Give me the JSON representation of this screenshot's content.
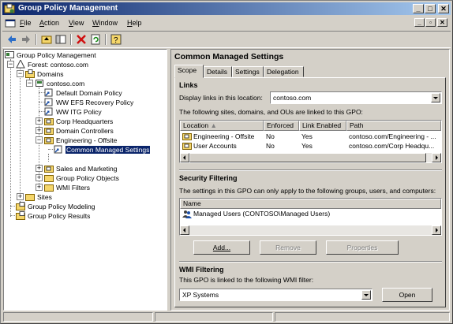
{
  "window": {
    "title": "Group Policy Management"
  },
  "menu": [
    {
      "label": "File",
      "u": "F"
    },
    {
      "label": "Action",
      "u": "A"
    },
    {
      "label": "View",
      "u": "V"
    },
    {
      "label": "Window",
      "u": "W"
    },
    {
      "label": "Help",
      "u": "H"
    }
  ],
  "tree": {
    "root": "Group Policy Management",
    "forest": "Forest: contoso.com",
    "domains": "Domains",
    "domain": "contoso.com",
    "items": [
      "Default Domain Policy",
      "WW EFS Recovery Policy",
      "WW ITG Policy",
      "Corp Headquarters",
      "Domain Controllers",
      "Engineering - Offsite",
      "Common Managed Settings",
      "Sales and Marketing",
      "Group Policy Objects",
      "WMI Filters"
    ],
    "sites": "Sites",
    "modeling": "Group Policy Modeling",
    "results": "Group Policy Results"
  },
  "gpo": {
    "title": "Common Managed Settings",
    "tabs": [
      "Scope",
      "Details",
      "Settings",
      "Delegation"
    ],
    "links": {
      "heading": "Links",
      "display_label": "Display links in this location:",
      "location": "contoso.com",
      "linked_note": "The following sites, domains, and OUs are linked to this GPO:",
      "columns": [
        "Location",
        "Enforced",
        "Link Enabled",
        "Path"
      ],
      "rows": [
        {
          "location": "Engineering - Offsite",
          "enforced": "No",
          "enabled": "Yes",
          "path": "contoso.com/Engineering - ..."
        },
        {
          "location": "User Accounts",
          "enforced": "No",
          "enabled": "Yes",
          "path": "contoso.com/Corp Headqu..."
        }
      ]
    },
    "security": {
      "heading": "Security Filtering",
      "note": "The settings in this GPO can only apply to the following groups, users, and computers:",
      "column": "Name",
      "rows": [
        "Managed Users (CONTOSO\\Managed Users)"
      ],
      "add": "Add...",
      "remove": "Remove",
      "properties": "Properties"
    },
    "wmi": {
      "heading": "WMI Filtering",
      "note": "This GPO is linked to the following WMI filter:",
      "filter": "XP Systems",
      "open": "Open"
    }
  },
  "colors": {
    "title_start": "#0a246a",
    "title_end": "#a6caf0",
    "folder": "#f5d66a",
    "selection": "#0a246a"
  }
}
